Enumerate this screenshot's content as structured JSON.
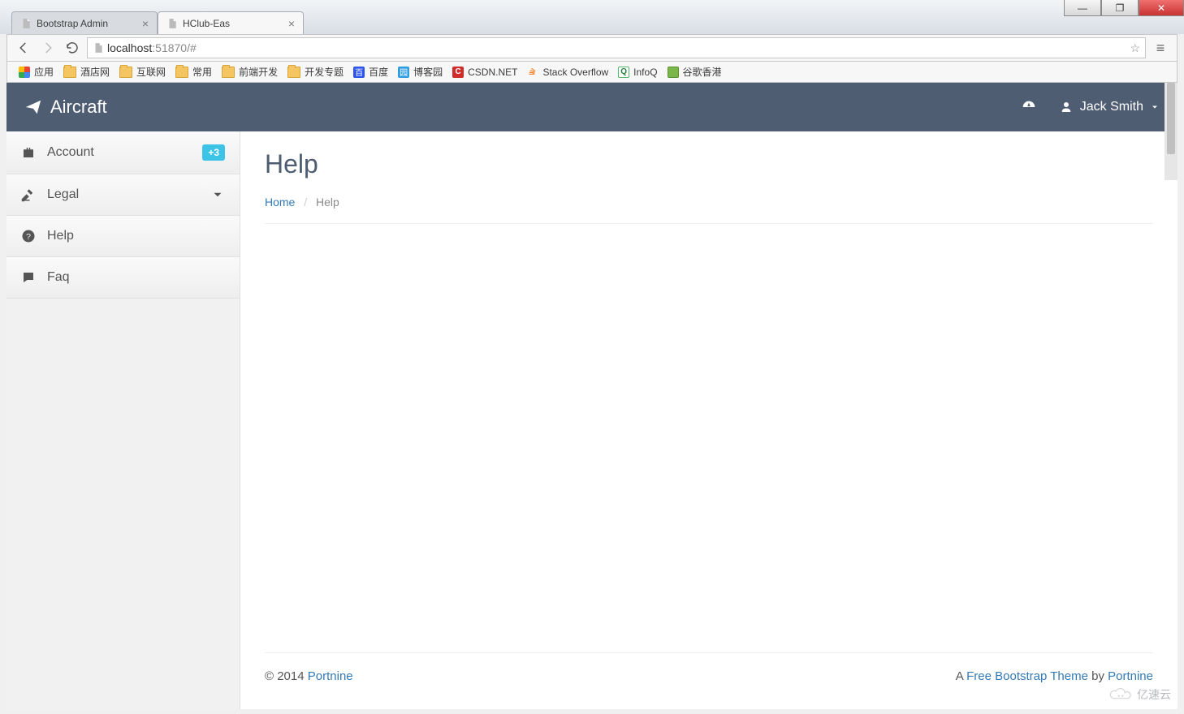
{
  "tabs": [
    {
      "title": "Bootstrap Admin"
    },
    {
      "title": "HClub-Eas"
    }
  ],
  "url": {
    "host": "localhost",
    "port": ":51870",
    "path": "/#"
  },
  "bookmarks": {
    "apps": "应用",
    "items": [
      "酒店网",
      "互联网",
      "常用",
      "前端开发",
      "开发专题"
    ],
    "baidu": "百度",
    "boke": "博客园",
    "csdn": "CSDN.NET",
    "so": "Stack Overflow",
    "infoq": "InfoQ",
    "gg": "谷歌香港"
  },
  "navbar": {
    "brand": "Aircraft",
    "user": "Jack Smith"
  },
  "sidebar": [
    {
      "icon": "briefcase",
      "label": "Account",
      "badge": "+3"
    },
    {
      "icon": "gavel",
      "label": "Legal",
      "chevron": true
    },
    {
      "icon": "question",
      "label": "Help"
    },
    {
      "icon": "comment",
      "label": "Faq"
    }
  ],
  "page": {
    "title": "Help",
    "crumb_home": "Home",
    "crumb_current": "Help"
  },
  "footer": {
    "copyright": "© 2014 ",
    "portnine": "Portnine",
    "right_a": "A ",
    "right_theme": "Free Bootstrap Theme",
    "right_by": " by ",
    "right_portnine": "Portnine"
  },
  "watermark": "亿速云"
}
